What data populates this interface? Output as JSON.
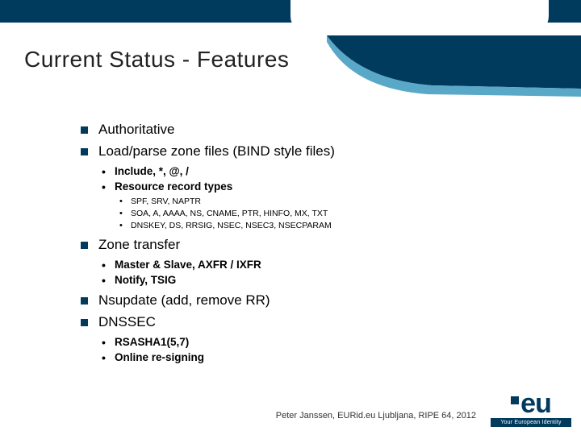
{
  "title": "Current Status - Features",
  "bullets": {
    "b0": "Authoritative",
    "b1": "Load/parse zone files (BIND style files)",
    "b1_sub": {
      "s0": "Include, *, @, /",
      "s1": "Resource record types",
      "s1_sub": {
        "t0": "SPF, SRV, NAPTR",
        "t1": "SOA, A, AAAA, NS, CNAME, PTR, HINFO, MX, TXT",
        "t2": "DNSKEY, DS, RRSIG, NSEC, NSEC3, NSECPARAM"
      }
    },
    "b2": "Zone transfer",
    "b2_sub": {
      "s0": "Master & Slave, AXFR / IXFR",
      "s1": "Notify, TSIG"
    },
    "b3": "Nsupdate (add, remove RR)",
    "b4": "DNSSEC",
    "b4_sub": {
      "s0": "RSASHA1(5,7)",
      "s1": "Online re-signing"
    }
  },
  "footer": "Peter Janssen, EURid.eu   Ljubljana, RIPE 64, 2012",
  "logo": {
    "text": "eu",
    "slogan": "Your European Identity"
  }
}
